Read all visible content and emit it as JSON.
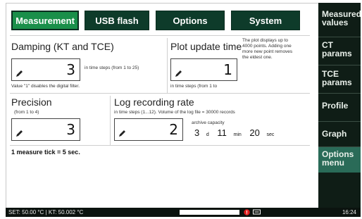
{
  "tabs": [
    {
      "label": "Measurement",
      "active": true
    },
    {
      "label": "USB flash"
    },
    {
      "label": "Options"
    },
    {
      "label": "System"
    }
  ],
  "damping": {
    "title": "Damping (KT and TCE)",
    "value": "3",
    "hint": "in time steps (from 1 to 25)",
    "note": "Value \"1\" disables the digital filter."
  },
  "plot_update": {
    "title": "Plot update time",
    "value": "1",
    "hint": "in time steps (from 1 to",
    "info": [
      "The plot displays up to",
      "4000 points. Adding one",
      "more new point removes",
      "the eldest one."
    ]
  },
  "precision": {
    "title": "Precision",
    "range": "(from 1 to 4)",
    "value": "3"
  },
  "log_recording": {
    "title": "Log recording rate",
    "hint": "in time steps (1...12). Volume of the log file = 30000 records",
    "value": "2",
    "archive_label": "archive capacity",
    "days": "3",
    "days_unit": "d",
    "minutes": "11",
    "minutes_unit": "min",
    "seconds": "20",
    "seconds_unit": "sec"
  },
  "tick_note": "1 measure tick = 5 sec.",
  "sidebar": [
    {
      "line1": "Measured",
      "line2": "values"
    },
    {
      "line1": "CT",
      "line2": "params"
    },
    {
      "line1": "TCE",
      "line2": "params"
    },
    {
      "line1": "Profile",
      "line2": ""
    },
    {
      "line1": "Graph",
      "line2": ""
    },
    {
      "line1": "Options",
      "line2": "menu",
      "active": true
    }
  ],
  "status": {
    "text": "SET: 50.00 °C | KT: 50.002 °C",
    "clock": "16:24"
  },
  "colors": {
    "tab_active": "#1a8f4a",
    "tab_inactive": "#0e3b2a",
    "sidebar_bg": "#0f1d16",
    "sidebar_active": "#2a6b58",
    "statusbar_bg": "#0b130f"
  }
}
